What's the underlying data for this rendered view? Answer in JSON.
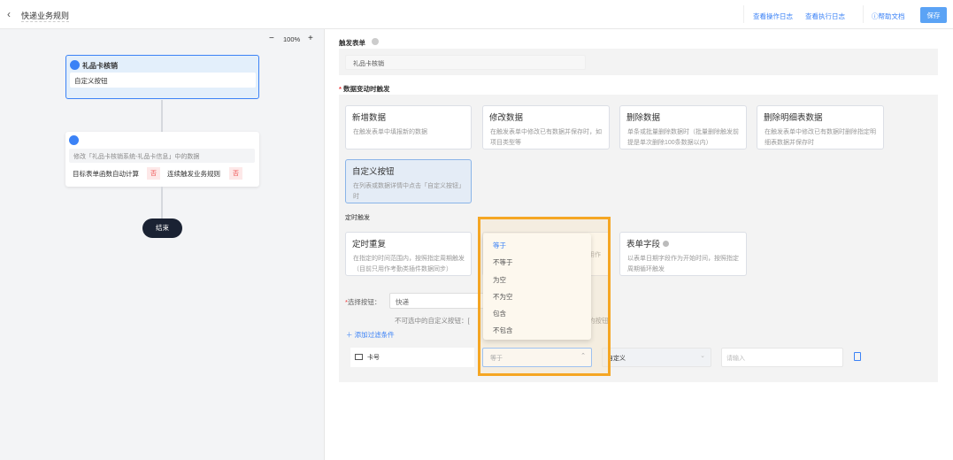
{
  "header": {
    "title": "快递业务规则",
    "links": [
      "查看操作日志",
      "查看执行日志"
    ],
    "help": "帮助文档",
    "save": "保存"
  },
  "canvas": {
    "zoom": "100%",
    "minus": "−",
    "plus": "+",
    "trigger_node": {
      "title": "礼品卡核销",
      "value": "自定义按钮"
    },
    "action_node": {
      "desc": "修改「礼品卡核销系统-礼品卡信息」中的数据",
      "opt1": "目标表单函数自动计算",
      "opt1_val": "否",
      "opt2": "连续触发业务规则",
      "opt2_val": "否"
    },
    "end": "结束"
  },
  "form": {
    "trigger_form_label": "触发表单",
    "trigger_form_value": "礼品卡核销",
    "data_change_label": "数据变动时触发",
    "cards": [
      {
        "title": "新增数据",
        "desc": "在触发表单中填报新的数据"
      },
      {
        "title": "修改数据",
        "desc": "在触发表单中修改已有数据并保存时，如项目类型等"
      },
      {
        "title": "删除数据",
        "desc": "单条或批量删除数据时（批量删除触发前提是单次删除100条数据以内）"
      },
      {
        "title": "删除明细表数据",
        "desc": "在触发表单中修改已有数据时删除指定明细表数据并保存时"
      },
      {
        "title": "自定义按钮",
        "desc": "在列表或数据详情中点击「自定义按钮」时"
      }
    ],
    "timed_label": "定时触发",
    "timed_cards": [
      {
        "title": "定时重复",
        "desc": "在指定的时间范围内，按照指定周期触发（目前只用作考勤类插件数据同步）"
      },
      {
        "title": "",
        "desc_fragment": "用作"
      },
      {
        "title": "表单字段",
        "desc": "以表单日期字段作为开始时间，按照指定周期循环触发"
      }
    ],
    "select_button_label": "选择按钮：",
    "select_button_value": "快递",
    "hint_prefix": "不可选中的自定义按钮：[",
    "hint_suffix": "的按钮",
    "add_filter": "添加过滤条件",
    "filter": {
      "field": "卡号",
      "operator": "等于",
      "value_type": "自定义",
      "value_placeholder": "请输入"
    },
    "operator_options": [
      "等于",
      "不等于",
      "为空",
      "不为空",
      "包含",
      "不包含"
    ],
    "selected_option": "等于"
  },
  "colors": {
    "accent": "#3b82f6",
    "highlight": "#f5a623",
    "end_node": "#1a2233"
  }
}
